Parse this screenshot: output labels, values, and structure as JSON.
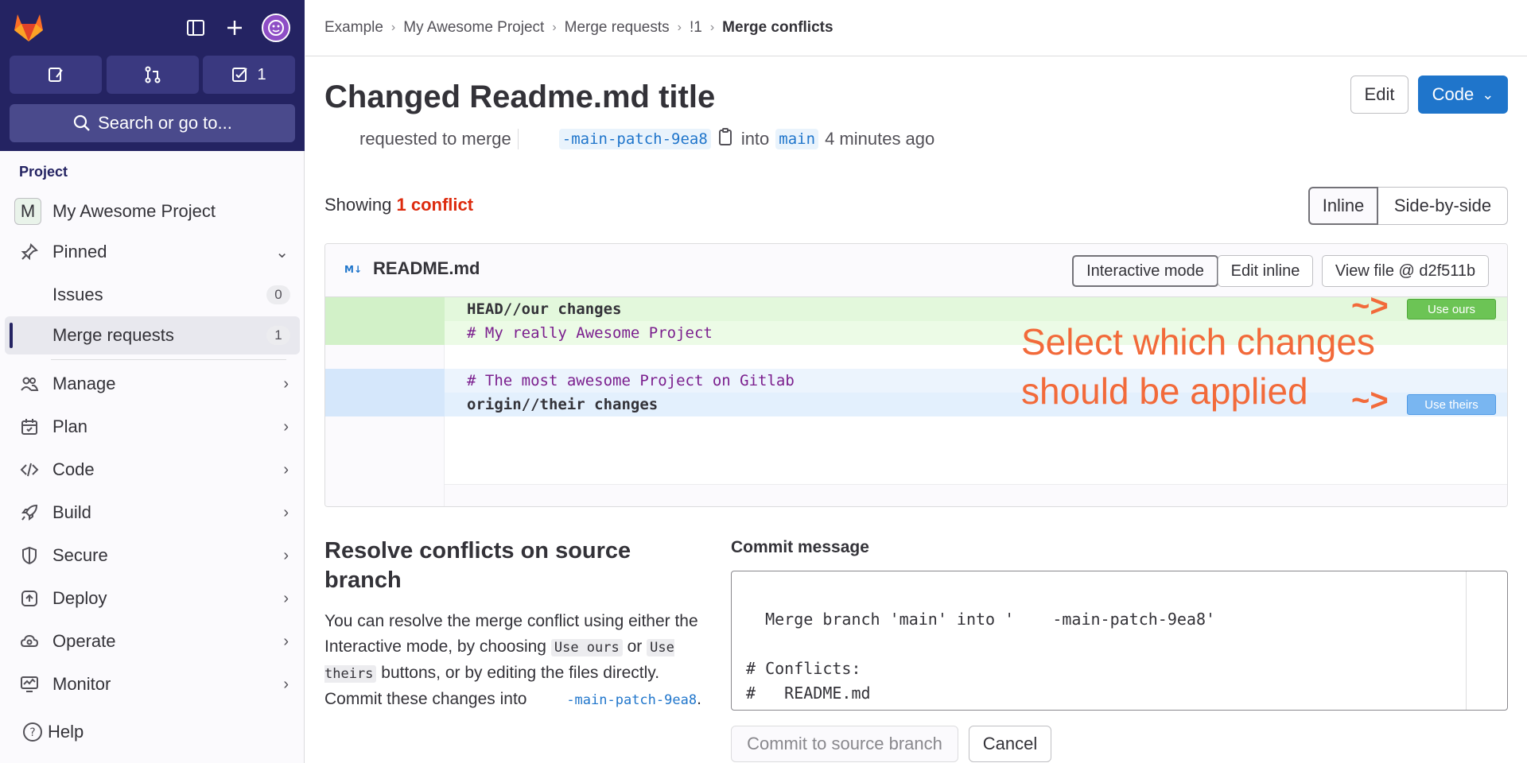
{
  "sidebar": {
    "todo_count": "1",
    "search_label": "Search or go to...",
    "section_label": "Project",
    "project_initial": "M",
    "project_name": "My Awesome Project",
    "pinned_label": "Pinned",
    "issues_label": "Issues",
    "issues_count": "0",
    "mr_label": "Merge requests",
    "mr_count": "1",
    "nav": [
      "Manage",
      "Plan",
      "Code",
      "Build",
      "Secure",
      "Deploy",
      "Operate",
      "Monitor"
    ],
    "help_label": "Help"
  },
  "breadcrumb": [
    "Example",
    "My Awesome Project",
    "Merge requests",
    "!1",
    "Merge conflicts"
  ],
  "header": {
    "title": "Changed Readme.md title",
    "edit_label": "Edit",
    "code_label": "Code",
    "requested": "requested to merge",
    "source_branch": "-main-patch-9ea8",
    "into": "into",
    "target_branch": "main",
    "time": "4 minutes ago"
  },
  "conflicts": {
    "showing": "Showing",
    "count_label": "1 conflict",
    "inline_label": "Inline",
    "side_label": "Side-by-side"
  },
  "file": {
    "name": "README.md",
    "interactive_label": "Interactive mode",
    "edit_inline_label": "Edit inline",
    "view_file_label": "View file @ d2f511b",
    "lines": [
      "HEAD//our changes",
      "# My really Awesome Project",
      "",
      "# The most awesome Project on Gitlab",
      "origin//their changes"
    ],
    "use_ours": "Use ours",
    "use_theirs": "Use theirs",
    "annotation_line1": "Select which changes",
    "annotation_line2": "should be applied",
    "arrow": "~>"
  },
  "resolve": {
    "heading": "Resolve conflicts on source branch",
    "p1": "You can resolve the merge conflict using either the Interactive mode, by choosing",
    "code1": "Use ours",
    "or": "or",
    "code2": "Use theirs",
    "p2": "buttons, or by editing the files directly. Commit these changes into",
    "branch": "-main-patch-9ea8",
    "end": "."
  },
  "commit": {
    "label": "Commit message",
    "message": "Merge branch 'main' into '    -main-patch-9ea8'\n\n# Conflicts:\n#   README.md",
    "commit_label": "Commit to source branch",
    "cancel_label": "Cancel"
  },
  "colors": {
    "sidebar_top": "#242362",
    "primary": "#1f75cb",
    "ours_bg": "#e3f8dc",
    "theirs_bg": "#e3f0fd",
    "annotation": "#f26a3a",
    "danger": "#dd2b0e"
  }
}
